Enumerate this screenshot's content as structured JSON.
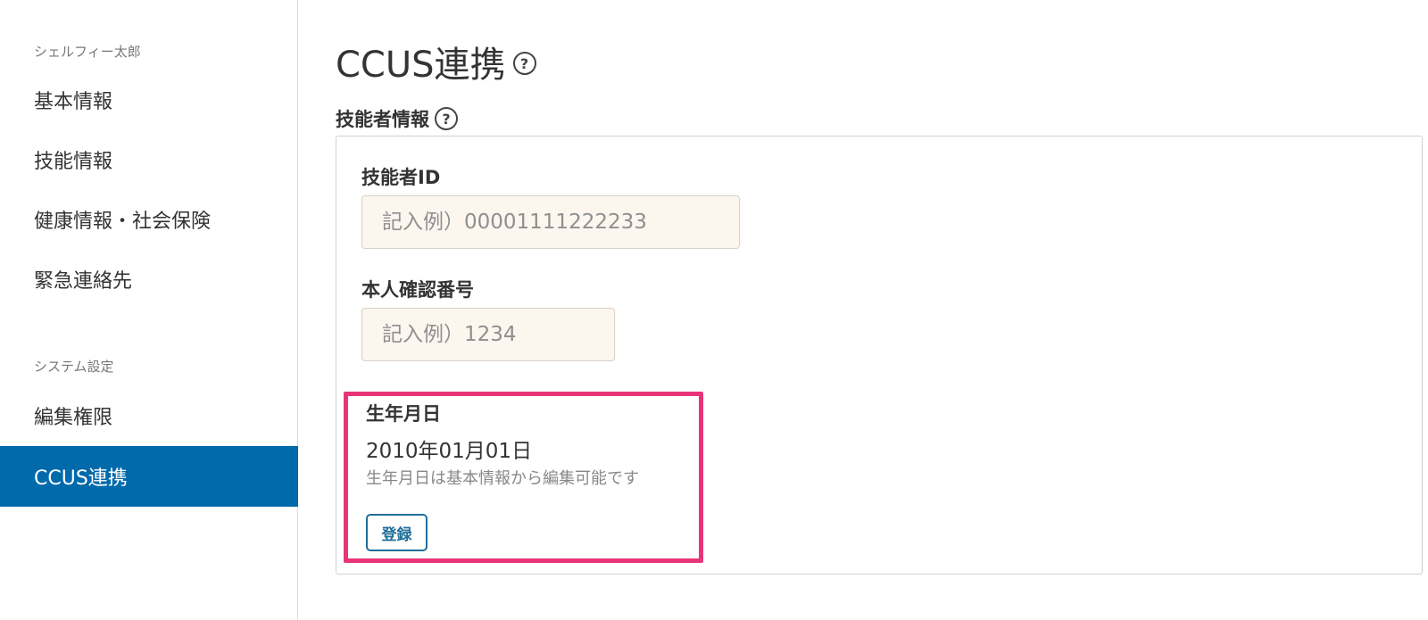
{
  "sidebar": {
    "group1_label": "シェルフィー太郎",
    "group1_items": [
      {
        "label": "基本情報"
      },
      {
        "label": "技能情報"
      },
      {
        "label": "健康情報・社会保険"
      },
      {
        "label": "緊急連絡先"
      }
    ],
    "group2_label": "システム設定",
    "group2_items": [
      {
        "label": "編集権限"
      },
      {
        "label": "CCUS連携",
        "active": true
      }
    ]
  },
  "main": {
    "title": "CCUS連携",
    "help_glyph": "?",
    "section_title": "技能者情報",
    "fields": {
      "worker_id": {
        "label": "技能者ID",
        "value": "",
        "placeholder": "記入例）00001111222233"
      },
      "identity_number": {
        "label": "本人確認番号",
        "value": "",
        "placeholder": "記入例）1234"
      }
    },
    "birth": {
      "label": "生年月日",
      "value": "2010年01月01日",
      "note": "生年月日は基本情報から編集可能です"
    },
    "register_label": "登録"
  },
  "colors": {
    "accent": "#006aab",
    "highlight": "#e8357a",
    "input_bg": "#fdf6ef",
    "button_text": "#1f6f99"
  }
}
